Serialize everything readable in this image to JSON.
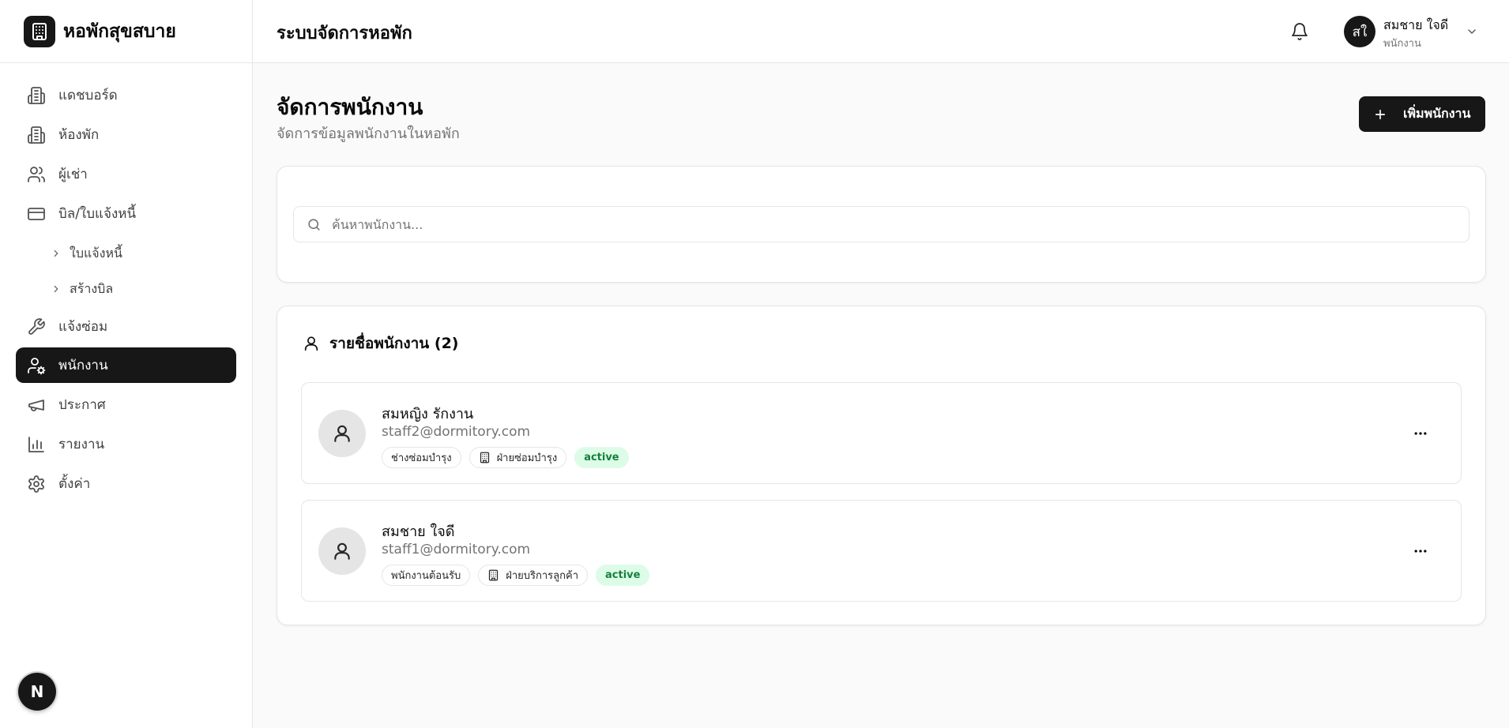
{
  "brand": {
    "title": "หอพักสุขสบาย"
  },
  "sidebar": {
    "items": [
      {
        "label": "แดชบอร์ด",
        "icon": "building-icon"
      },
      {
        "label": "ห้องพัก",
        "icon": "building-icon"
      },
      {
        "label": "ผู้เช่า",
        "icon": "users-icon"
      },
      {
        "label": "บิล/ใบแจ้งหนี้",
        "icon": "credit-card-icon"
      },
      {
        "label": "แจ้งซ่อม",
        "icon": "wrench-icon"
      },
      {
        "label": "พนักงาน",
        "icon": "user-cog-icon",
        "active": true
      },
      {
        "label": "ประกาศ",
        "icon": "megaphone-icon"
      },
      {
        "label": "รายงาน",
        "icon": "bar-chart-icon"
      },
      {
        "label": "ตั้งค่า",
        "icon": "gear-icon"
      }
    ],
    "subitems": [
      {
        "label": "ใบแจ้งหนี้"
      },
      {
        "label": "สร้างบิล"
      }
    ],
    "dev_badge": "N"
  },
  "topbar": {
    "title": "ระบบจัดการหอพัก",
    "user": {
      "initials": "สใ",
      "name": "สมชาย ใจดี",
      "role": "พนักงาน"
    }
  },
  "page": {
    "title": "จัดการพนักงาน",
    "subtitle": "จัดการข้อมูลพนักงานในหอพัก",
    "add_button": "เพิ่มพนักงาน"
  },
  "search": {
    "placeholder": "ค้นหาพนักงาน...",
    "value": ""
  },
  "staff_list": {
    "title": "รายชื่อพนักงาน (2)",
    "rows": [
      {
        "name": "สมหญิง รักงาน",
        "email": "staff2@dormitory.com",
        "position": "ช่างซ่อมบำรุง",
        "department": "ฝ่ายซ่อมบำรุง",
        "status": "active"
      },
      {
        "name": "สมชาย ใจดี",
        "email": "staff1@dormitory.com",
        "position": "พนักงานต้อนรับ",
        "department": "ฝ่ายบริการลูกค้า",
        "status": "active"
      }
    ]
  },
  "colors": {
    "primary": "#171717",
    "status_active_bg": "#dcfce7",
    "status_active_text": "#15803d",
    "muted_text": "#737373",
    "border": "#e5e5e5"
  }
}
